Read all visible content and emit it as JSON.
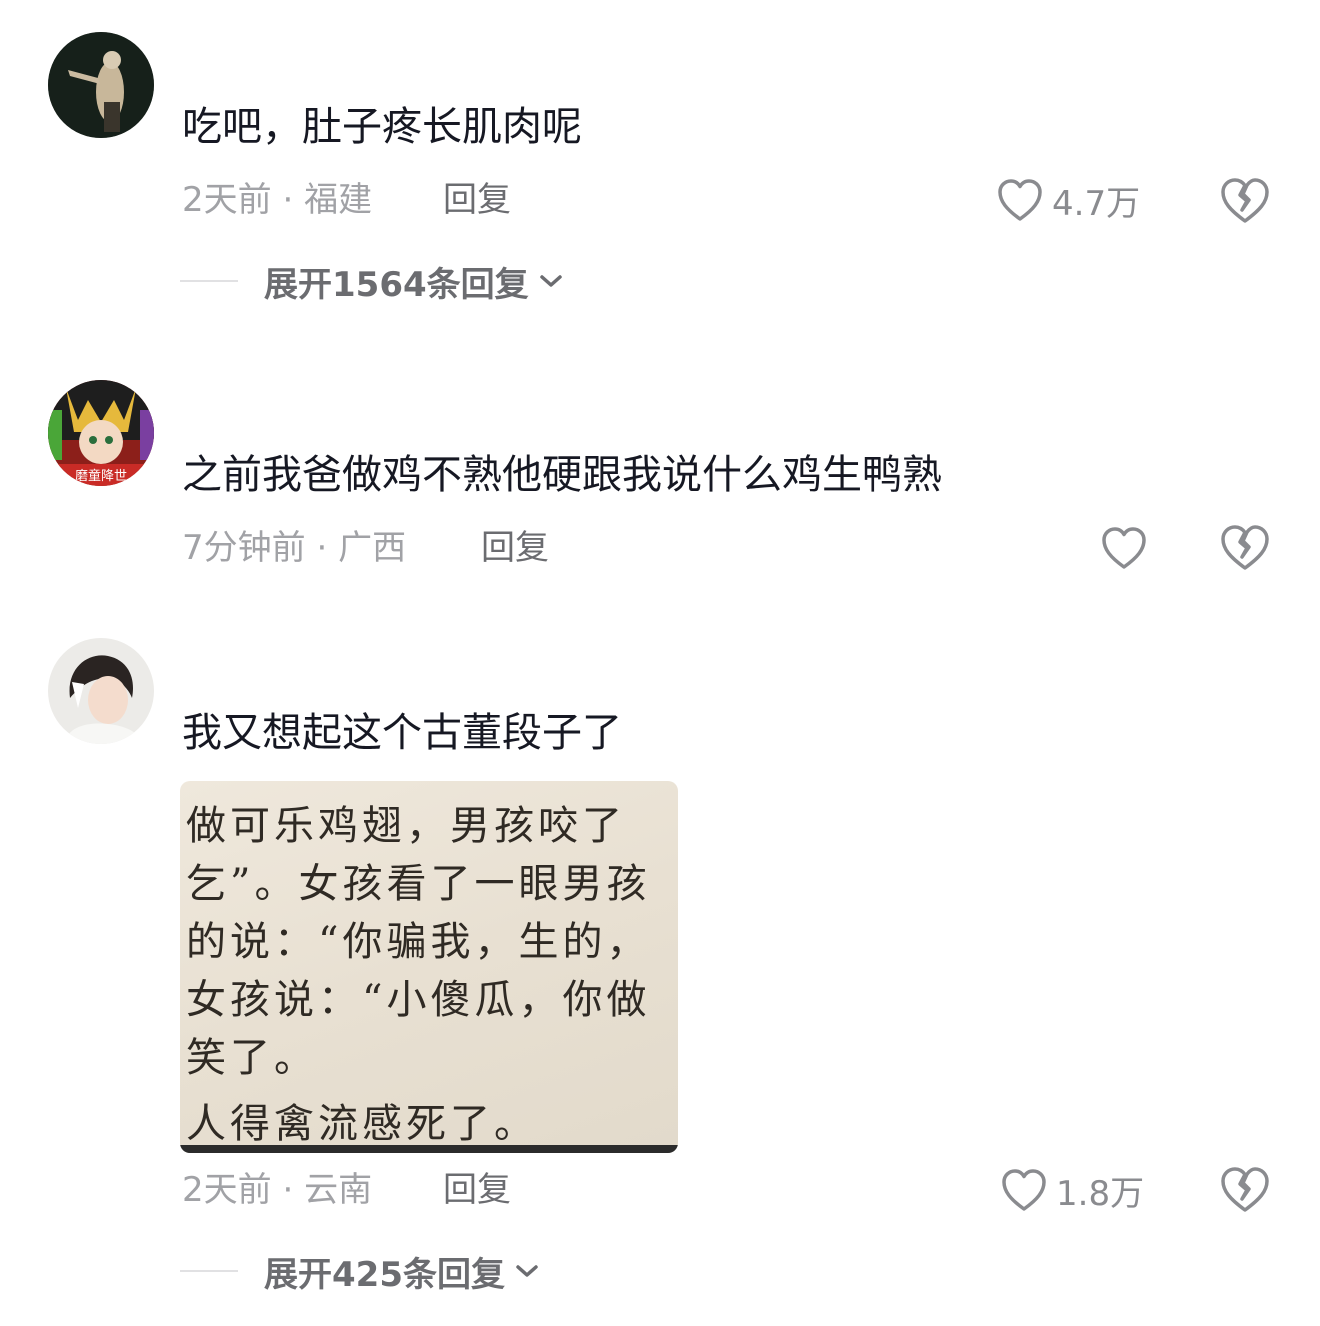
{
  "comments": [
    {
      "text": "吃吧，肚子疼长肌肉呢",
      "time": "2天前",
      "location": "福建",
      "reply_label": "回复",
      "like_count": "4.7万",
      "expand_label": "展开1564条回复"
    },
    {
      "text": "之前我爸做鸡不熟他硬跟我说什么鸡生鸭熟",
      "time": "7分钟前",
      "location": "广西",
      "reply_label": "回复",
      "like_count": ""
    },
    {
      "text": "我又想起这个古董段子了",
      "time": "2天前",
      "location": "云南",
      "reply_label": "回复",
      "like_count": "1.8万",
      "expand_label": "展开425条回复",
      "image_lines": [
        "做可乐鸡翅，男孩咬了",
        "乞”。女孩看了一眼男孩",
        "的说：“你骗我，生的，",
        "女孩说：“小傻瓜，你做",
        "笑了。",
        "人得禽流感死了。"
      ],
      "avatar_badge": "磨童降世"
    }
  ],
  "meta_separator": " · ",
  "colors": {
    "text": "#161823",
    "meta": "#a1a2a6",
    "reply": "#6b6c70",
    "icon": "#8a8b8f"
  }
}
